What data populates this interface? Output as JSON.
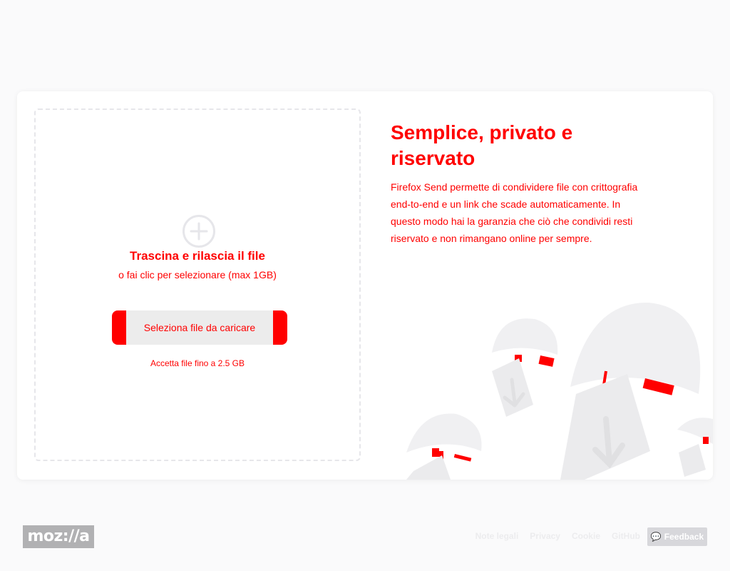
{
  "upload": {
    "title": "Trascina e rilascia il file",
    "subtitle": "o fai clic per selezionare (max 1GB)",
    "select_button": "Seleziona file da caricare",
    "size_limit": "Accetta file fino a 2.5 GB"
  },
  "intro": {
    "title": "Semplice, privato e riservato",
    "description": "Firefox Send permette di condividere file con crittografia end-to-end e un link che scade automaticamente. In questo modo hai la garanzia che ciò che condividi resti riservato e non rimangano online per sempre."
  },
  "footer": {
    "logo": "moz://a",
    "links": [
      "Note legali",
      "Privacy",
      "Cookie",
      "GitHub"
    ],
    "feedback_icon": "💬",
    "feedback": "Feedback"
  },
  "colors": {
    "accent": "#ff0000",
    "background": "#fafafb",
    "card": "#ffffff",
    "button_fill": "#ececec"
  }
}
